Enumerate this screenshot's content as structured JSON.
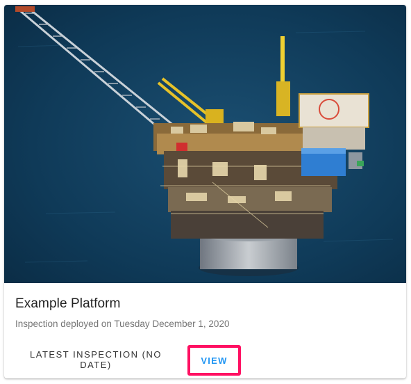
{
  "card": {
    "image_alt": "offshore oil platform",
    "title": "Example Platform",
    "subtitle": "Inspection deployed on Tuesday December 1, 2020",
    "actions": {
      "latest_label": "LATEST INSPECTION (NO DATE)",
      "view_label": "VIEW"
    }
  },
  "colors": {
    "accent": "#2196f3",
    "highlight": "#ff1062",
    "sea": "#0f3a58"
  }
}
